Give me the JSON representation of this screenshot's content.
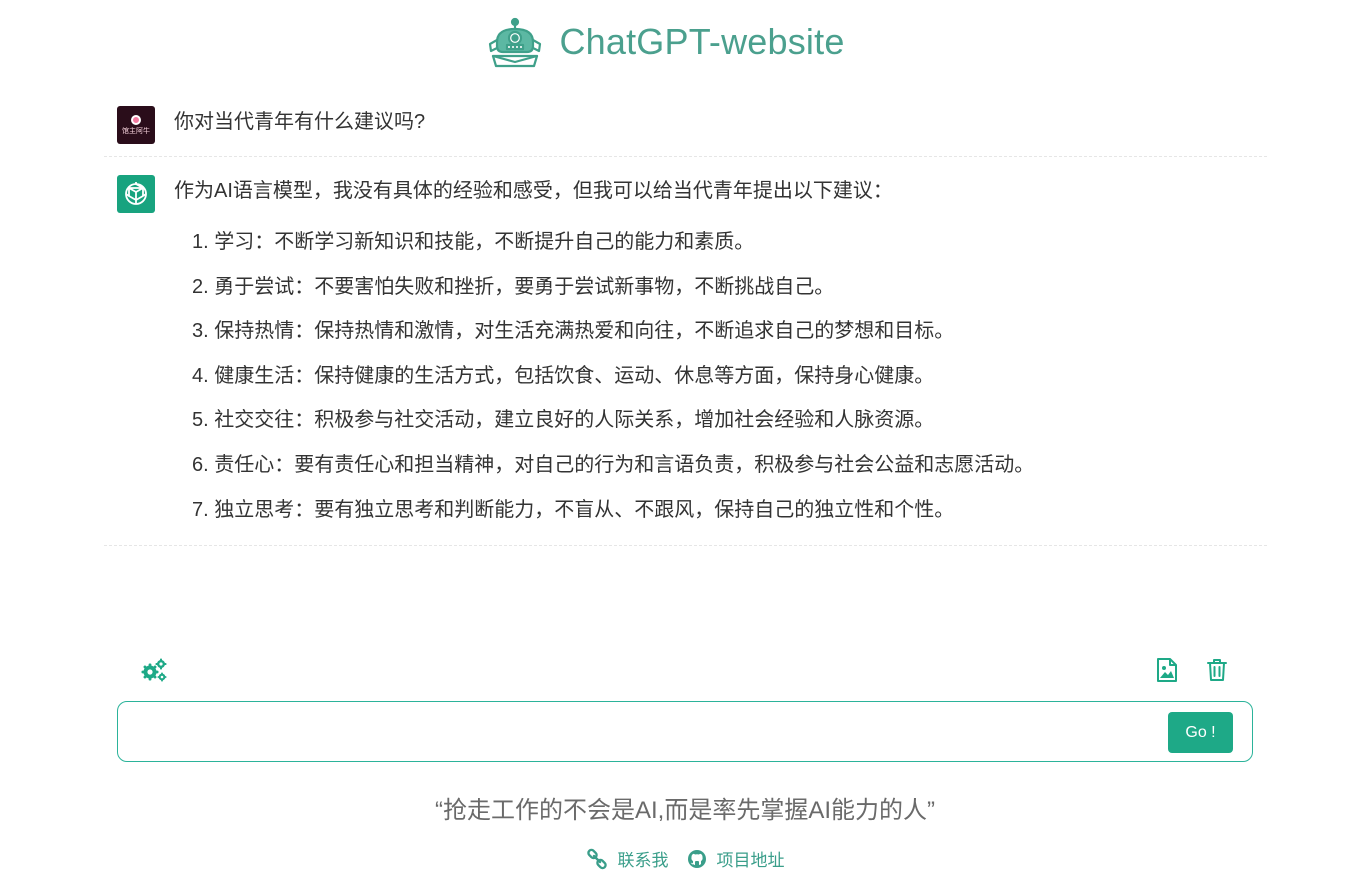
{
  "header": {
    "title": "ChatGPT-website",
    "brand_color": "#4ba08e"
  },
  "messages": [
    {
      "role": "user",
      "avatar": "user-avatar",
      "text": "你对当代青年有什么建议吗?"
    },
    {
      "role": "assistant",
      "avatar": "openai-logo-icon",
      "intro": "作为AI语言模型，我没有具体的经验和感受，但我可以给当代青年提出以下建议：",
      "items": [
        "1. 学习：不断学习新知识和技能，不断提升自己的能力和素质。",
        "2. 勇于尝试：不要害怕失败和挫折，要勇于尝试新事物，不断挑战自己。",
        "3. 保持热情：保持热情和激情，对生活充满热爱和向往，不断追求自己的梦想和目标。",
        "4. 健康生活：保持健康的生活方式，包括饮食、运动、休息等方面，保持身心健康。",
        "5. 社交交往：积极参与社交活动，建立良好的人际关系，增加社会经验和人脉资源。",
        "6. 责任心：要有责任心和担当精神，对自己的行为和言语负责，积极参与社会公益和志愿活动。",
        "7. 独立思考：要有独立思考和判断能力，不盲从、不跟风，保持自己的独立性和个性。"
      ]
    }
  ],
  "toolbar": {
    "settings_icon": "gears-icon",
    "image_icon": "image-icon",
    "delete_icon": "trash-icon"
  },
  "input": {
    "value": "",
    "placeholder": "",
    "go_label": "Go !"
  },
  "slogan": "“抢走工作的不会是AI,而是率先掌握AI能力的人”",
  "footer": {
    "contact_label": "联系我",
    "project_label": "项目地址"
  },
  "colors": {
    "accent": "#1ea987",
    "footer_link": "#3a9e8a"
  }
}
